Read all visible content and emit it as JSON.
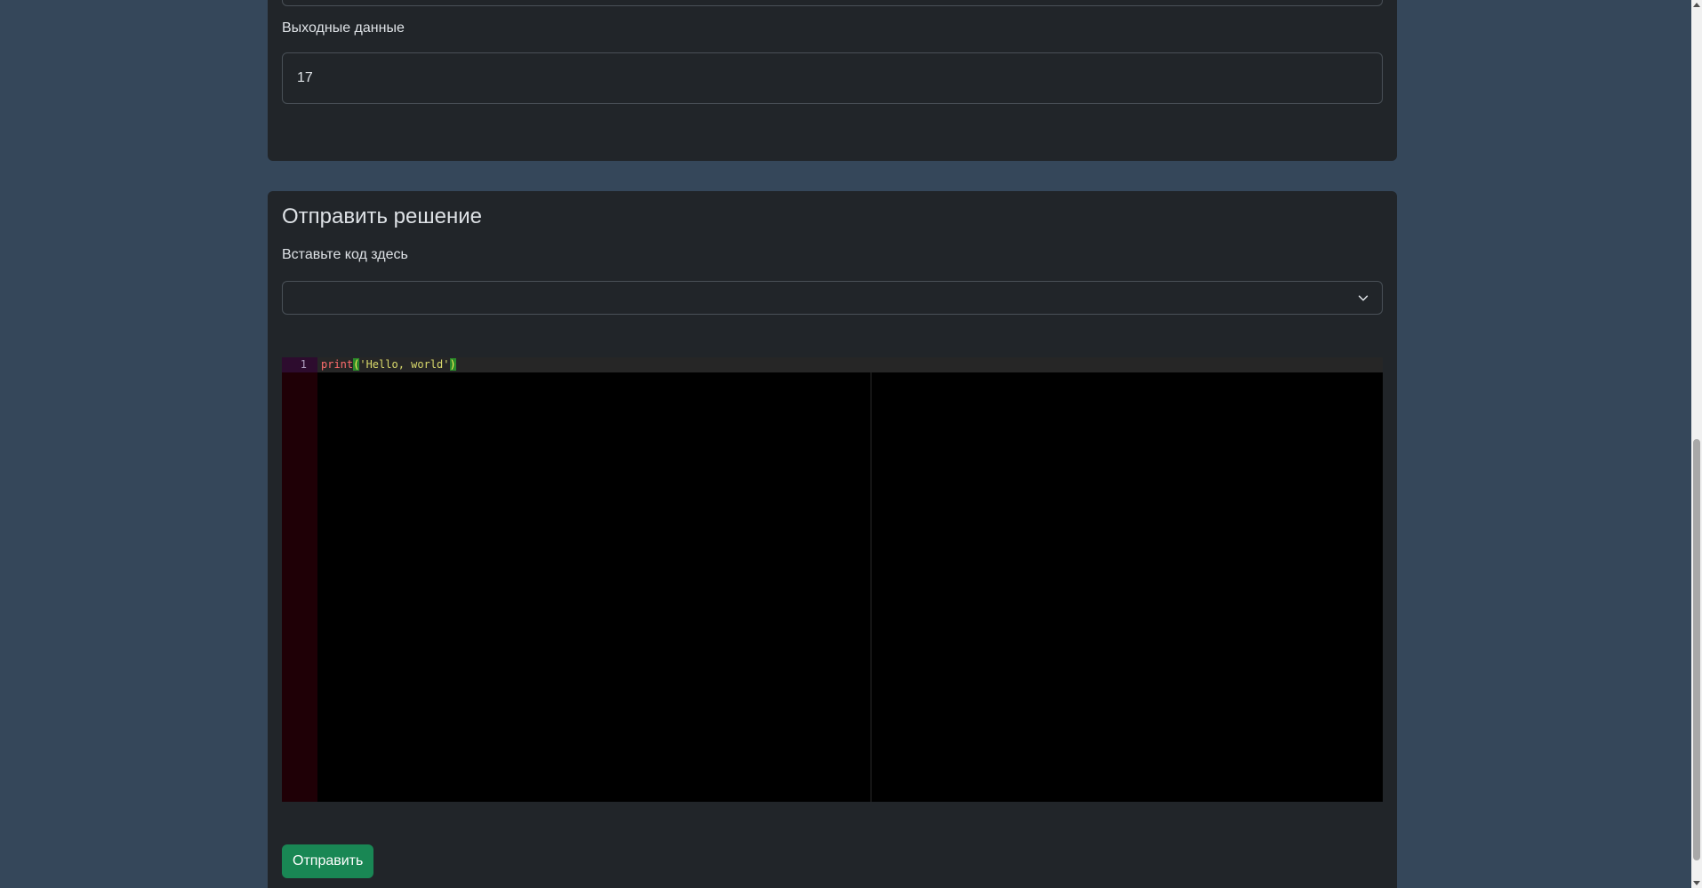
{
  "output_section": {
    "label": "Выходные данные",
    "value": "17"
  },
  "submit_section": {
    "title": "Отправить решение",
    "paste_label": "Вставьте код здесь",
    "language_select": {
      "selected": ""
    },
    "editor": {
      "line_number": "1",
      "code": {
        "fn": "print",
        "open_paren": "(",
        "string": "'Hello, world'",
        "close_paren": ")"
      }
    },
    "submit_label": "Отправить"
  },
  "colors": {
    "page_bg": "#35475a",
    "card_bg": "#212529",
    "button_green": "#198754",
    "editor_bg": "#000000",
    "gutter_bg": "#1f0006"
  },
  "icons": {
    "select_chevron": "chevron-down-icon"
  }
}
